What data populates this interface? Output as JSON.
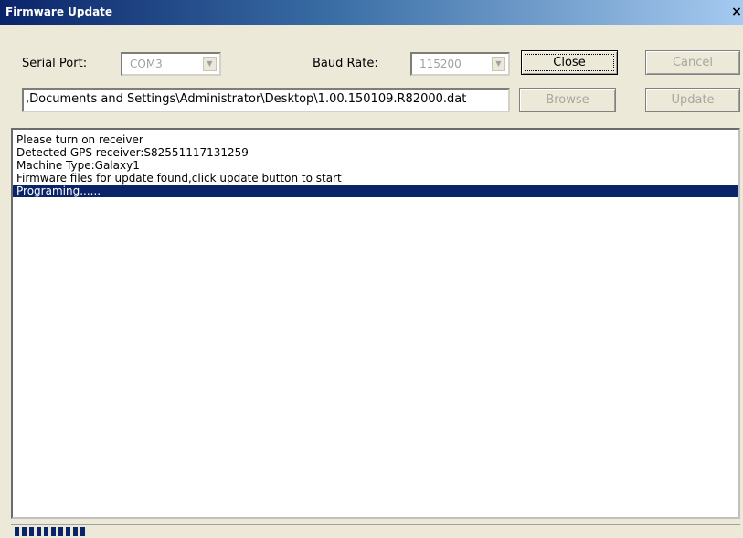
{
  "window": {
    "title": "Firmware Update",
    "close_glyph": "×"
  },
  "serial_port": {
    "label": "Serial Port:",
    "value": "COM3"
  },
  "baud_rate": {
    "label": "Baud Rate:",
    "value": "115200"
  },
  "buttons": {
    "close": "Close",
    "cancel": "Cancel",
    "browse": "Browse",
    "update": "Update"
  },
  "file_path": ",Documents and Settings\\Administrator\\Desktop\\1.00.150109.R82000.dat",
  "log": {
    "lines": [
      "Please turn on receiver",
      "Detected GPS receiver:S82551117131259",
      "Machine Type:Galaxy1",
      "Firmware files for update found,click update button to start",
      "Programing......"
    ],
    "selected_index": 4
  },
  "progress": {
    "fraction": 0.1
  }
}
